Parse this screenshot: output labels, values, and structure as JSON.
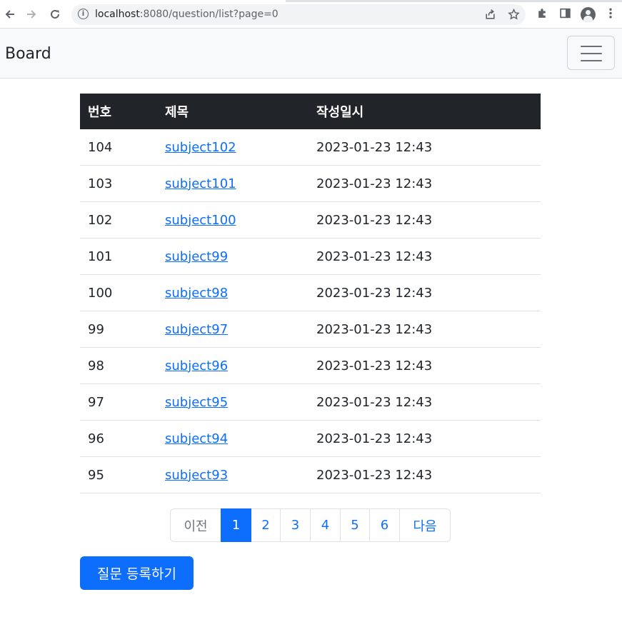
{
  "browser": {
    "url_host": "localhost",
    "url_rest": ":8080/question/list?page=0",
    "back_icon": "arrow-left-icon",
    "forward_icon": "arrow-right-icon",
    "reload_icon": "reload-icon"
  },
  "navbar": {
    "brand": "Board"
  },
  "table": {
    "headers": [
      "번호",
      "제목",
      "작성일시"
    ],
    "rows": [
      {
        "num": "104",
        "subject": "subject102",
        "date": "2023-01-23 12:43"
      },
      {
        "num": "103",
        "subject": "subject101",
        "date": "2023-01-23 12:43"
      },
      {
        "num": "102",
        "subject": "subject100",
        "date": "2023-01-23 12:43"
      },
      {
        "num": "101",
        "subject": "subject99",
        "date": "2023-01-23 12:43"
      },
      {
        "num": "100",
        "subject": "subject98",
        "date": "2023-01-23 12:43"
      },
      {
        "num": "99",
        "subject": "subject97",
        "date": "2023-01-23 12:43"
      },
      {
        "num": "98",
        "subject": "subject96",
        "date": "2023-01-23 12:43"
      },
      {
        "num": "97",
        "subject": "subject95",
        "date": "2023-01-23 12:43"
      },
      {
        "num": "96",
        "subject": "subject94",
        "date": "2023-01-23 12:43"
      },
      {
        "num": "95",
        "subject": "subject93",
        "date": "2023-01-23 12:43"
      }
    ]
  },
  "pagination": {
    "prev": "이전",
    "pages": [
      "1",
      "2",
      "3",
      "4",
      "5",
      "6"
    ],
    "current": "1",
    "next": "다음"
  },
  "actions": {
    "create_label": "질문 등록하기"
  },
  "colors": {
    "primary": "#0d6efd",
    "header_bg": "#212529",
    "navbar_bg": "#f8f9fa"
  }
}
